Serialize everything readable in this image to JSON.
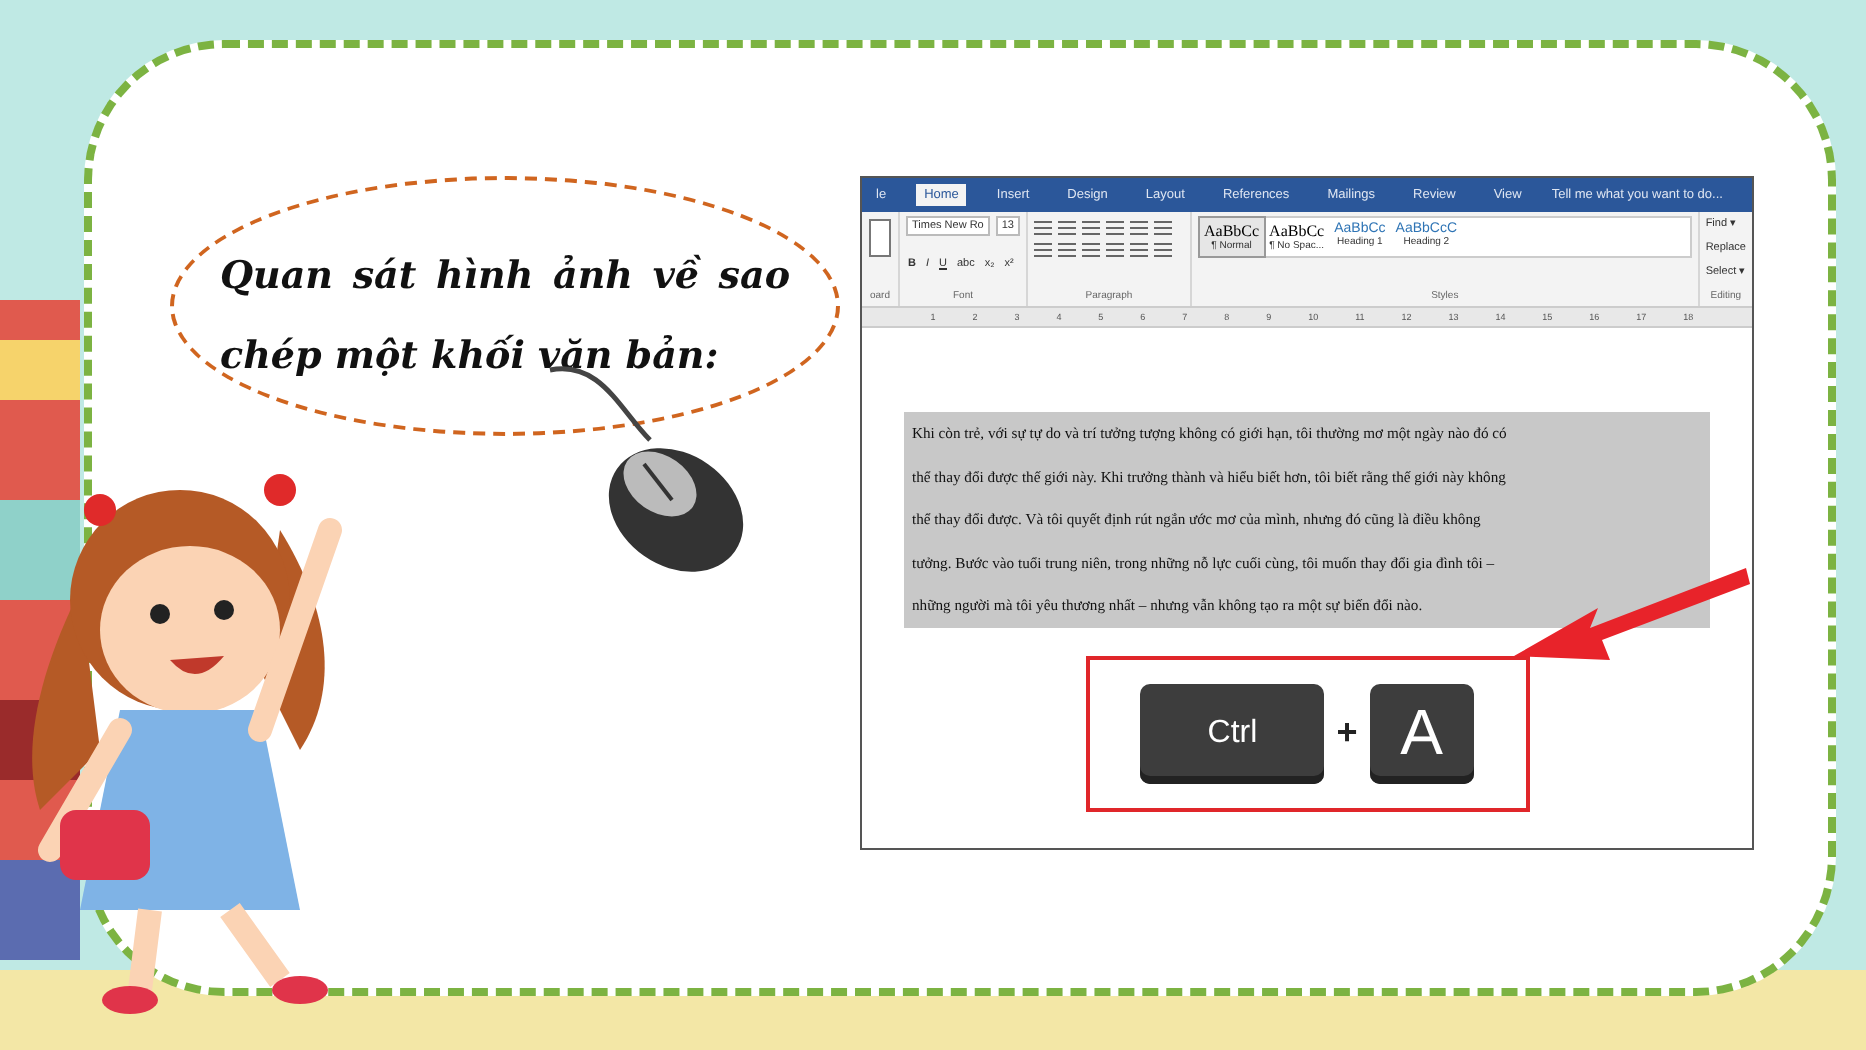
{
  "bubble": {
    "text": "Quan sát hình ảnh về sao chép một khối văn bản:"
  },
  "word": {
    "tabs": [
      {
        "label": "le",
        "selected": false
      },
      {
        "label": "Home",
        "selected": true
      },
      {
        "label": "Insert",
        "selected": false
      },
      {
        "label": "Design",
        "selected": false
      },
      {
        "label": "Layout",
        "selected": false
      },
      {
        "label": "References",
        "selected": false
      },
      {
        "label": "Mailings",
        "selected": false
      },
      {
        "label": "Review",
        "selected": false
      },
      {
        "label": "View",
        "selected": false
      }
    ],
    "tell_me": "Tell me what you want to do...",
    "clipboard_label": "oard",
    "font": {
      "name": "Times New Ro",
      "size": "13",
      "buttons": [
        "B",
        "I",
        "U",
        "abc",
        "x₂",
        "x²"
      ],
      "label": "Font"
    },
    "paragraph_label": "Paragraph",
    "styles": [
      {
        "sample": "AaBbCc",
        "name": "¶ Normal",
        "selected": true,
        "kind": "body"
      },
      {
        "sample": "AaBbCc",
        "name": "¶ No Spac...",
        "selected": false,
        "kind": "body"
      },
      {
        "sample": "AaBbCc",
        "name": "Heading 1",
        "selected": false,
        "kind": "heading"
      },
      {
        "sample": "AaBbCcC",
        "name": "Heading 2",
        "selected": false,
        "kind": "heading"
      }
    ],
    "styles_label": "Styles",
    "editing": [
      "Find ▾",
      "Replace",
      "Select ▾"
    ],
    "editing_label": "Editing",
    "ruler": [
      "1",
      "2",
      "3",
      "4",
      "5",
      "6",
      "7",
      "8",
      "9",
      "10",
      "11",
      "12",
      "13",
      "14",
      "15",
      "16",
      "17",
      "18"
    ],
    "lines": [
      "Khi còn trẻ, với sự tự do và trí tưởng tượng không có giới hạn, tôi thường mơ một ngày nào đó có",
      "thể thay đổi được thế giới này. Khi trưởng thành và hiểu biết hơn, tôi biết rằng thế giới này không",
      "thể thay đổi được.    Và tôi quyết định rút ngắn ước mơ của mình, nhưng đó cũng là điều không",
      "tưởng. Bước vào tuổi trung niên, trong những nỗ lực cuối cùng, tôi muốn thay đổi gia đình tôi –",
      "những người mà tôi yêu thương nhất – nhưng vẫn không tạo ra một sự biến đổi nào."
    ],
    "keys": [
      {
        "label": "Ctrl",
        "kind": "key"
      },
      {
        "label": "+",
        "kind": "plus"
      },
      {
        "label": "A",
        "kind": "key"
      }
    ]
  }
}
